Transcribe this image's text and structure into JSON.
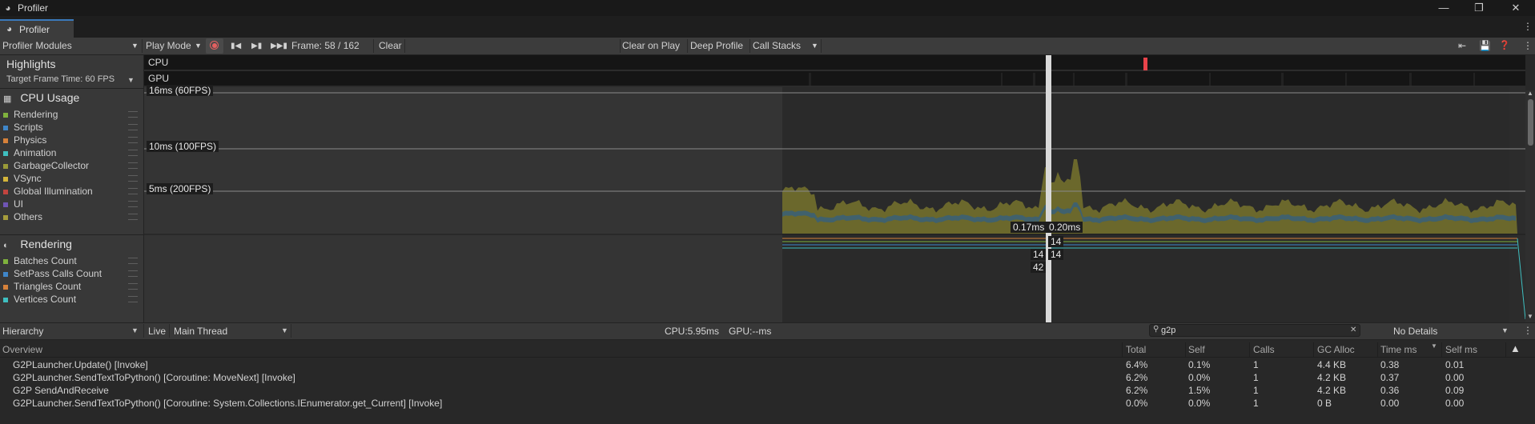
{
  "window": {
    "title": "Profiler",
    "tab_label": "Profiler"
  },
  "toolbar": {
    "modules_label": "Profiler Modules",
    "play_mode_label": "Play Mode",
    "frame_label": "Frame: 58 / 162",
    "clear_label": "Clear",
    "clear_on_play_label": "Clear on Play",
    "deep_profile_label": "Deep Profile",
    "call_stacks_label": "Call Stacks"
  },
  "highlights": {
    "title": "Highlights",
    "target_label": "Target Frame Time: 60 FPS",
    "cpu_label": "CPU",
    "gpu_label": "GPU"
  },
  "cpu_module": {
    "title": "CPU Usage",
    "legend": [
      {
        "label": "Rendering",
        "color": "#7fb23d"
      },
      {
        "label": "Scripts",
        "color": "#3f86c9"
      },
      {
        "label": "Physics",
        "color": "#d6813a"
      },
      {
        "label": "Animation",
        "color": "#3fbfc0"
      },
      {
        "label": "GarbageCollector",
        "color": "#999a38"
      },
      {
        "label": "VSync",
        "color": "#d4b53a"
      },
      {
        "label": "Global Illumination",
        "color": "#c2443f"
      },
      {
        "label": "UI",
        "color": "#6f55b5"
      },
      {
        "label": "Others",
        "color": "#a59c3c"
      }
    ],
    "fps_lines": [
      "16ms (60FPS)",
      "10ms (100FPS)",
      "5ms (200FPS)"
    ],
    "tooltip_left": "0.17ms",
    "tooltip_right": "0.20ms"
  },
  "rendering_module": {
    "title": "Rendering",
    "legend": [
      {
        "label": "Batches Count",
        "color": "#7fb23d"
      },
      {
        "label": "SetPass Calls Count",
        "color": "#3f86c9"
      },
      {
        "label": "Triangles Count",
        "color": "#d6813a"
      },
      {
        "label": "Vertices Count",
        "color": "#3fbfc0"
      }
    ],
    "values": {
      "top": "14",
      "mid_left": "14",
      "mid_right": "14",
      "bottom": "42"
    }
  },
  "details": {
    "view_label": "Hierarchy",
    "live_label": "Live",
    "thread_label": "Main Thread",
    "cpu_time": "CPU:5.95ms",
    "gpu_time": "GPU:--ms",
    "search_value": "g2p",
    "details_label": "No Details"
  },
  "table": {
    "headers": [
      "Overview",
      "Total",
      "Self",
      "Calls",
      "GC Alloc",
      "Time ms",
      "Self ms"
    ],
    "rows": [
      [
        "G2PLauncher.Update() [Invoke]",
        "6.4%",
        "0.1%",
        "1",
        "4.4 KB",
        "0.38",
        "0.01"
      ],
      [
        "G2PLauncher.SendTextToPython() [Coroutine: MoveNext] [Invoke]",
        "6.2%",
        "0.0%",
        "1",
        "4.2 KB",
        "0.37",
        "0.00"
      ],
      [
        "G2P SendAndReceive",
        "6.2%",
        "1.5%",
        "1",
        "4.2 KB",
        "0.36",
        "0.09"
      ],
      [
        "G2PLauncher.SendTextToPython() [Coroutine: System.Collections.IEnumerator.get_Current] [Invoke]",
        "0.0%",
        "0.0%",
        "1",
        "0 B",
        "0.00",
        "0.00"
      ]
    ]
  },
  "icons": [
    "profiler-icon",
    "record-icon",
    "first-frame-icon",
    "prev-frame-icon",
    "next-frame-icon",
    "last-frame-icon",
    "menu-icon",
    "minimize-icon",
    "maximize-icon",
    "close-icon",
    "search-icon",
    "clear-search-icon",
    "sort-icon"
  ]
}
